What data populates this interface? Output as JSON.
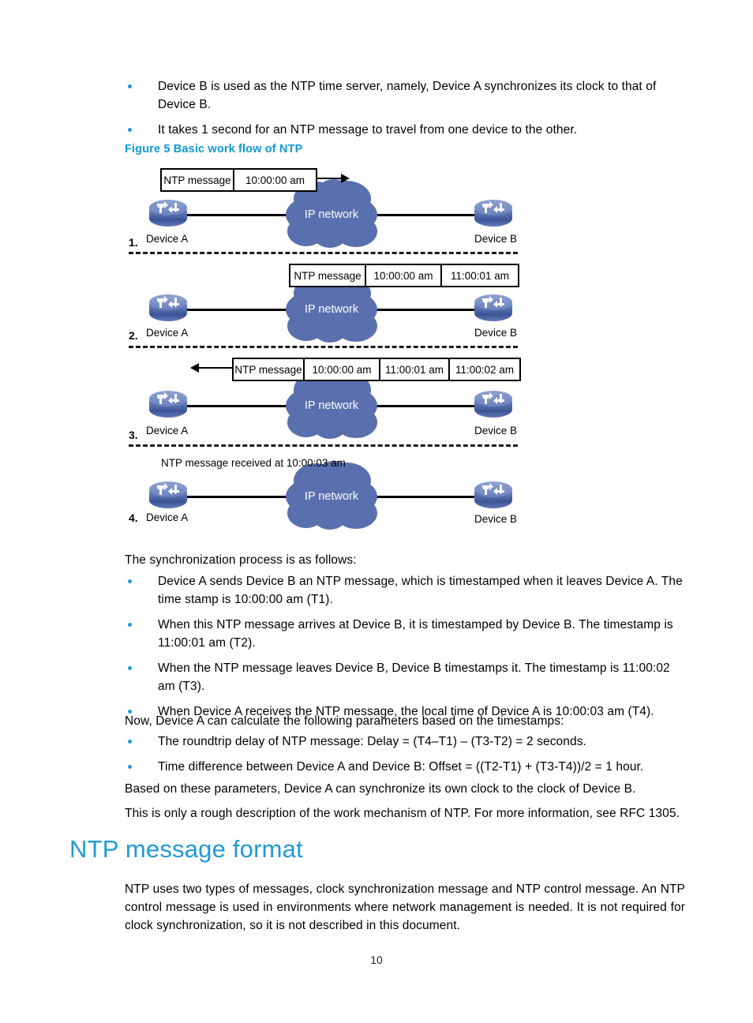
{
  "intro_bullets": [
    "Device B is used as the NTP time server, namely, Device A synchronizes its clock to that of Device B.",
    "It takes 1 second for an NTP message to travel from one device to the other."
  ],
  "figure": {
    "caption": "Figure 5 Basic work flow of NTP",
    "cloud_label": "IP network",
    "device_a_label": "Device A",
    "device_b_label": "Device B",
    "steps": [
      {
        "number": "1.",
        "cells": [
          "NTP message",
          "10:00:00 am"
        ],
        "direction": "right"
      },
      {
        "number": "2.",
        "cells": [
          "NTP message",
          "10:00:00 am",
          "11:00:01 am"
        ],
        "direction": "none"
      },
      {
        "number": "3.",
        "cells": [
          "NTP message",
          "10:00:00 am",
          "11:00:01 am",
          "11:00:02 am"
        ],
        "direction": "left"
      },
      {
        "number": "4.",
        "note": "NTP message received at 10:00:03 am",
        "direction": "none"
      }
    ]
  },
  "process_intro": "The synchronization process is as follows:",
  "process_bullets": [
    "Device A sends Device B an NTP message, which is timestamped when it leaves Device A. The time stamp is 10:00:00 am (T1).",
    "When this NTP message arrives at Device B, it is timestamped by Device B. The timestamp is 11:00:01 am (T2).",
    "When the NTP message leaves Device B, Device B timestamps it. The timestamp is 11:00:02 am (T3).",
    "When Device A receives the NTP message, the local time of Device A is 10:00:03 am (T4)."
  ],
  "calc_intro": "Now, Device A can calculate the following parameters based on the timestamps:",
  "calc_bullets": [
    "The roundtrip delay of NTP message: Delay = (T4–T1) – (T3-T2) = 2 seconds.",
    "Time difference between Device A and Device B: Offset = ((T2-T1) + (T3-T4))/2 = 1 hour."
  ],
  "closing_paragraphs": [
    "Based on these parameters, Device A can synchronize its own clock to the clock of Device B.",
    "This is only a rough description of the work mechanism of NTP. For more information, see RFC 1305."
  ],
  "section": {
    "heading": "NTP message format",
    "body": "NTP uses two types of messages, clock synchronization message and NTP control message. An NTP control message is used in environments where network management is needed. It is not required for clock synchronization, so it is not described in this document."
  },
  "page_number": "10",
  "colors": {
    "accent": "#1f9ad6",
    "cloud": "#5a6fad",
    "bullet": "#1f9ad6"
  }
}
